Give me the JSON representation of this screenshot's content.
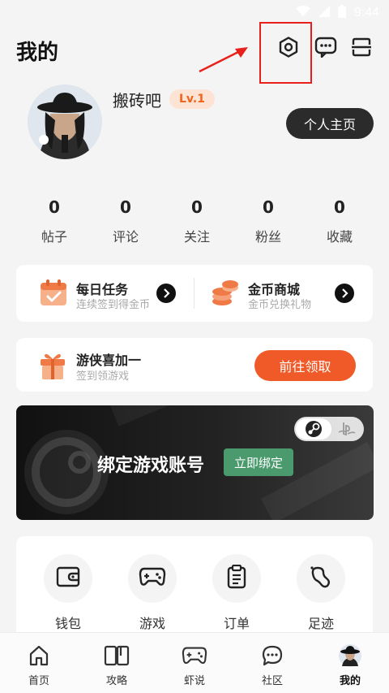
{
  "status_bar": {
    "time": "9:44"
  },
  "header": {
    "title": "我的"
  },
  "profile": {
    "username": "搬砖吧",
    "level": "Lv.1",
    "homepage_label": "个人主页"
  },
  "stats": [
    {
      "value": "0",
      "label": "帖子"
    },
    {
      "value": "0",
      "label": "评论"
    },
    {
      "value": "0",
      "label": "关注"
    },
    {
      "value": "0",
      "label": "粉丝"
    },
    {
      "value": "0",
      "label": "收藏"
    }
  ],
  "tasks": {
    "daily": {
      "title": "每日任务",
      "subtitle": "连续签到得金币"
    },
    "shop": {
      "title": "金币商城",
      "subtitle": "金币兑换礼物"
    }
  },
  "gift": {
    "title": "游侠喜加一",
    "subtitle": "签到领游戏",
    "button": "前往领取"
  },
  "bind": {
    "title": "绑定游戏账号",
    "button": "立即绑定"
  },
  "tools": [
    {
      "label": "钱包",
      "icon": "wallet-icon"
    },
    {
      "label": "游戏",
      "icon": "gamepad-icon"
    },
    {
      "label": "订单",
      "icon": "order-icon"
    },
    {
      "label": "足迹",
      "icon": "footprint-icon"
    }
  ],
  "tabs": [
    {
      "label": "首页",
      "icon": "home-icon"
    },
    {
      "label": "攻略",
      "icon": "book-icon"
    },
    {
      "label": "虾说",
      "icon": "gamepad-icon"
    },
    {
      "label": "社区",
      "icon": "chat-icon"
    },
    {
      "label": "我的",
      "icon": "avatar-icon",
      "active": true
    }
  ],
  "colors": {
    "accent": "#f05a28",
    "bind_green": "#4a9a6e",
    "level_text": "#f0641e",
    "highlight_red": "#e8201c"
  }
}
